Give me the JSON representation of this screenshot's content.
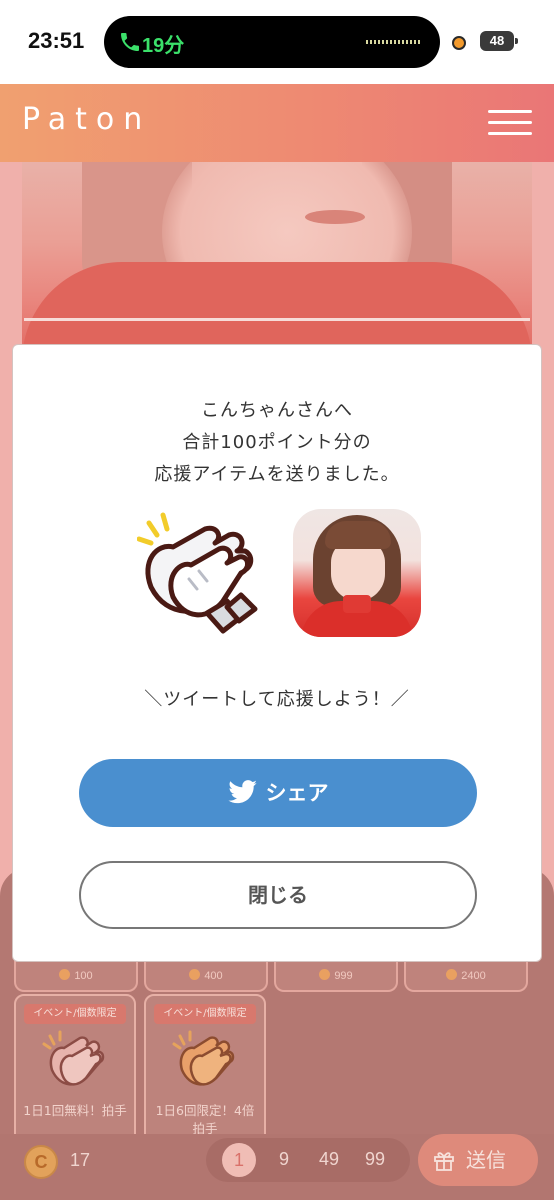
{
  "status_bar": {
    "time": "23:51",
    "call_duration": "19分",
    "battery": "48"
  },
  "header": {
    "logo": "Paton"
  },
  "gift_values": [
    "100",
    "400",
    "999",
    "2400"
  ],
  "items": [
    {
      "badge": "イベント/個数限定",
      "title": "1日1回無料！拍手"
    },
    {
      "badge": "イベント/個数限定",
      "title": "1日6回限定！4倍拍手"
    }
  ],
  "footer": {
    "coin_symbol": "C",
    "coin_count": "17",
    "amounts": [
      "1",
      "9",
      "49",
      "99"
    ],
    "send_label": "送信"
  },
  "modal": {
    "line1": "こんちゃんさんへ",
    "line2": "合計100ポイント分の",
    "line3": "応援アイテムを送りました。",
    "tweet_prompt": "＼ツイートして応援しよう！／",
    "share_label": "シェア",
    "close_label": "閉じる"
  },
  "colors": {
    "twitter_blue": "#4a8fcf",
    "header_start": "#f0a070",
    "header_end": "#ea7676"
  }
}
